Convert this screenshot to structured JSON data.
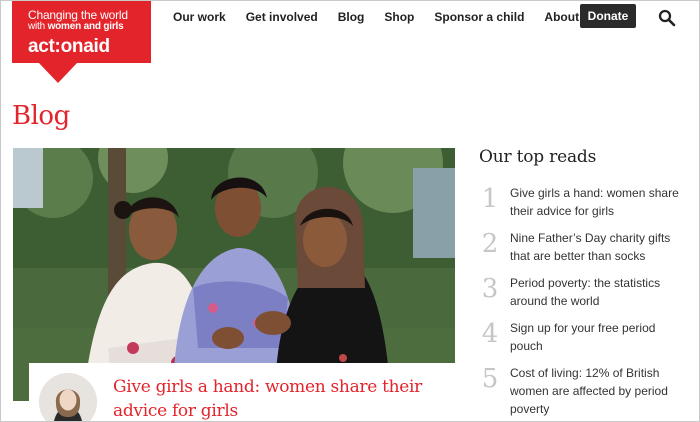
{
  "logo": {
    "tagline_line1": "Changing the world",
    "tagline_line2_prefix": "with ",
    "tagline_line2_bold": "women and girls",
    "wordmark": "act:onaid"
  },
  "nav": {
    "items": [
      "Our work",
      "Get involved",
      "Blog",
      "Shop",
      "Sponsor a child",
      "About us"
    ],
    "donate_label": "Donate"
  },
  "page": {
    "title": "Blog"
  },
  "featured": {
    "title": "Give girls a hand: women share their advice for girls"
  },
  "top_reads": {
    "heading": "Our top reads",
    "items": [
      {
        "number": "1",
        "title": "Give girls a hand: women share their advice for girls"
      },
      {
        "number": "2",
        "title": "Nine Father’s Day charity gifts that are better than socks"
      },
      {
        "number": "3",
        "title": "Period poverty: the statistics around the world"
      },
      {
        "number": "4",
        "title": "Sign up for your free period pouch"
      },
      {
        "number": "5",
        "title": "Cost of living: 12% of British women are affected by period poverty"
      }
    ]
  },
  "colors": {
    "brand_red": "#e3242b",
    "donate_bg": "#2b2b2b",
    "number_grey": "#c6c6c6"
  },
  "icons": {
    "search": "search-icon"
  }
}
